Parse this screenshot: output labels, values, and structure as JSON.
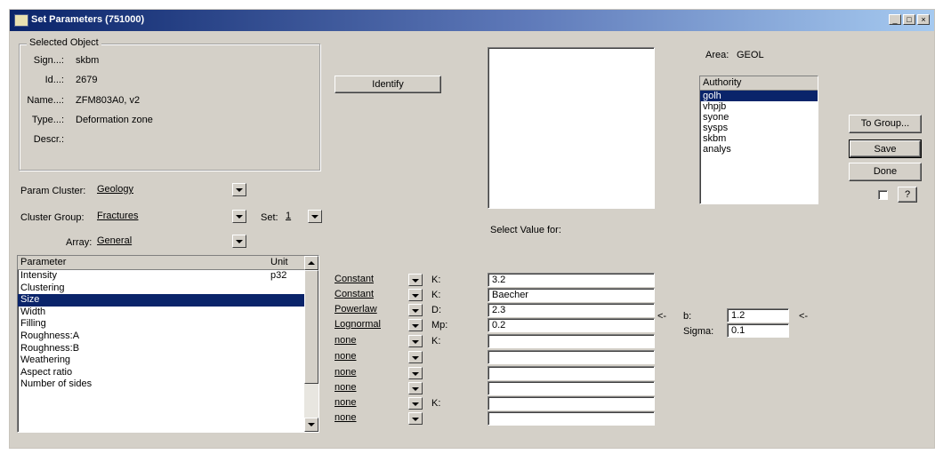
{
  "window": {
    "title": "Set Parameters (751000)",
    "min_btn": "_",
    "max_btn": "□",
    "close_btn": "×"
  },
  "selected_object": {
    "legend": "Selected Object",
    "rows": [
      {
        "label": "Sign...:",
        "value": "skbm"
      },
      {
        "label": "Id...:",
        "value": "2679"
      },
      {
        "label": "Name...:",
        "value": "ZFM803A0, v2"
      },
      {
        "label": "Type...:",
        "value": "Deformation zone"
      },
      {
        "label": "Descr.:",
        "value": ""
      }
    ]
  },
  "identify_button": "Identify",
  "param_cluster": {
    "label": "Param Cluster:",
    "value": "Geology"
  },
  "cluster_group": {
    "label": "Cluster Group:",
    "value": "Fractures"
  },
  "set": {
    "label": "Set:",
    "value": "1"
  },
  "array": {
    "label": "Array:",
    "value": "General"
  },
  "parameter_list": {
    "headers": {
      "parameter": "Parameter",
      "unit": "Unit"
    },
    "rows": [
      {
        "name": "Intensity",
        "unit": "p32",
        "selected": false
      },
      {
        "name": "Clustering",
        "unit": "",
        "selected": false
      },
      {
        "name": "Size",
        "unit": "",
        "selected": true
      },
      {
        "name": "Width",
        "unit": "",
        "selected": false
      },
      {
        "name": "Filling",
        "unit": "",
        "selected": false
      },
      {
        "name": "Roughness:A",
        "unit": "",
        "selected": false
      },
      {
        "name": "Roughness:B",
        "unit": "",
        "selected": false
      },
      {
        "name": "Weathering",
        "unit": "",
        "selected": false
      },
      {
        "name": "Aspect ratio",
        "unit": "",
        "selected": false
      },
      {
        "name": "Number of sides",
        "unit": "",
        "selected": false
      }
    ]
  },
  "distribution_rows": [
    {
      "dist": "Constant",
      "param": "K:",
      "value": "3.2"
    },
    {
      "dist": "Constant",
      "param": "K:",
      "value": "Baecher"
    },
    {
      "dist": "Powerlaw",
      "param": "D:",
      "value": "2.3"
    },
    {
      "dist": "Lognormal",
      "param": "Mp:",
      "value": "0.2"
    },
    {
      "dist": "none",
      "param": "K:",
      "value": ""
    },
    {
      "dist": "none",
      "param": "",
      "value": ""
    },
    {
      "dist": "none",
      "param": "",
      "value": ""
    },
    {
      "dist": "none",
      "param": "",
      "value": ""
    },
    {
      "dist": "none",
      "param": "K:",
      "value": ""
    },
    {
      "dist": "none",
      "param": "",
      "value": ""
    }
  ],
  "select_value_label": "Select Value for:",
  "area": {
    "label": "Area:",
    "value": "GEOL"
  },
  "authority": {
    "header": "Authority",
    "items": [
      "golh",
      "vhpjb",
      "syone",
      "sysps",
      "skbm",
      "analys"
    ],
    "selected_index": 0
  },
  "buttons": {
    "to_group": "To Group...",
    "save": "Save",
    "done": "Done",
    "help": "?"
  },
  "extra_params": {
    "arrow_left": "<-",
    "arrow_right": "<-",
    "b_label": "b:",
    "b_value": "1.2",
    "sigma_label": "Sigma:",
    "sigma_value": "0.1"
  },
  "colors": {
    "title_start": "#0a246a",
    "title_end": "#a6caf0",
    "face": "#d4d0c8",
    "selection": "#0a246a"
  }
}
